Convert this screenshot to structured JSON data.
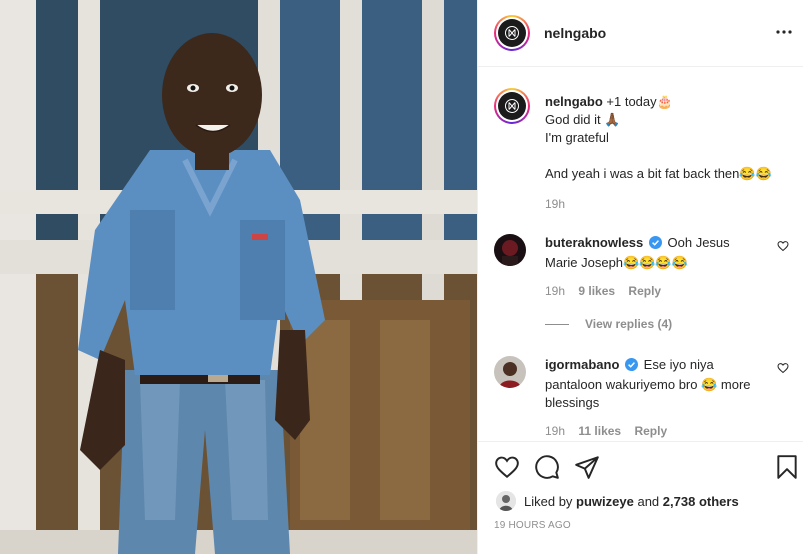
{
  "post": {
    "image_description_icon": "photo-icon",
    "author": "nelngabo",
    "more_icon": "more-horizontal-icon"
  },
  "caption": {
    "username": "nelngabo",
    "line1": "+1 today🎂",
    "line2": "God did it 🙏🏾",
    "line3": "I'm grateful",
    "line4": "And yeah i was a bit fat back then😂😂",
    "time": "19h"
  },
  "comments": [
    {
      "username": "buteraknowless",
      "verified": true,
      "text": "Ooh Jesus Marie Joseph😂😂😂😂",
      "time": "19h",
      "likes": "9 likes",
      "reply": "Reply",
      "view_replies": "View replies (4)"
    },
    {
      "username": "igormabano",
      "verified": true,
      "text": "Ese iyo niya pantaloon wakuriyemo bro 😂 more blessings",
      "time": "19h",
      "likes": "11 likes",
      "reply": "Reply"
    }
  ],
  "actions": {
    "like_icon": "heart-icon",
    "comment_icon": "comment-icon",
    "share_icon": "send-icon",
    "save_icon": "bookmark-icon"
  },
  "likes": {
    "prefix": "Liked by",
    "user": "puwizeye",
    "and": "and",
    "count": "2,738 others"
  },
  "posted_at": "19 HOURS AGO",
  "colors": {
    "text": "#262626",
    "muted": "#8e8e8e",
    "verified": "#3897f0",
    "border": "#efefef"
  }
}
